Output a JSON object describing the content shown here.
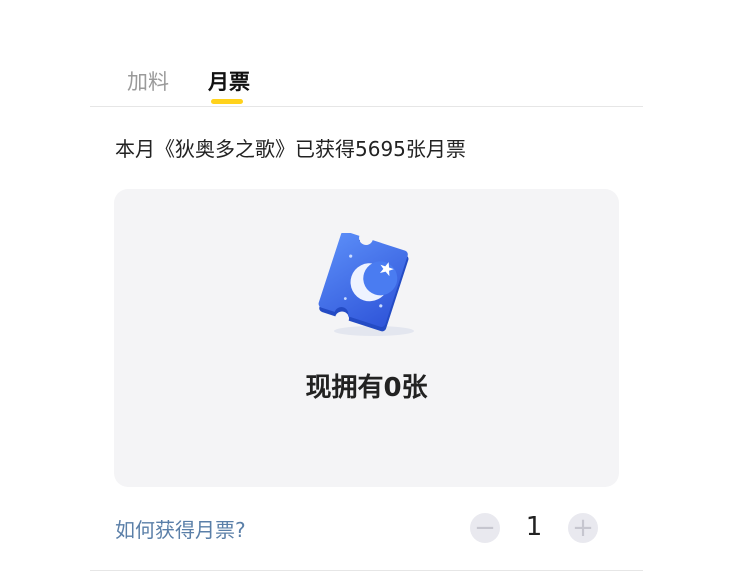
{
  "tabs": {
    "add": "加料",
    "ticket": "月票"
  },
  "summary": "本月《狄奥多之歌》已获得5695张月票",
  "card": {
    "owned_text": "现拥有0张"
  },
  "how_link": "如何获得月票?",
  "stepper": {
    "minus": "−",
    "quantity": "1",
    "plus": "+"
  },
  "icons": {
    "ticket": "moon-ticket-icon"
  },
  "colors": {
    "accent": "#ffd21c",
    "link": "#5a7fa8",
    "card_bg": "#f4f4f6",
    "ticket_blue": "#3d6ff0"
  }
}
